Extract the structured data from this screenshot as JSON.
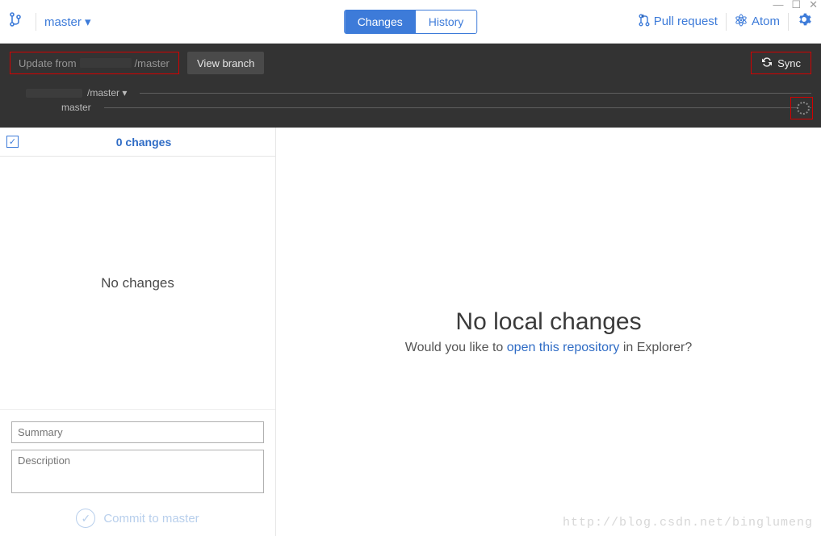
{
  "window_controls": {
    "min": "—",
    "max": "☐",
    "close": "✕"
  },
  "header": {
    "branch_label": "master ▾",
    "tabs": {
      "changes": "Changes",
      "history": "History"
    },
    "pull_request": "Pull request",
    "atom": "Atom"
  },
  "darkbar": {
    "update_prefix": "Update from",
    "update_suffix": "/master",
    "view_branch": "View branch",
    "sync": "Sync",
    "line1_suffix": "/master ▾",
    "line2": "master"
  },
  "sidebar": {
    "changes_count": "0 changes",
    "no_changes": "No changes",
    "summary_ph": "Summary",
    "description_ph": "Description",
    "commit_label": "Commit to master"
  },
  "content": {
    "title": "No local changes",
    "sub_pre": "Would you like to ",
    "sub_link": "open this repository",
    "sub_post": " in Explorer?"
  },
  "watermark": "http://blog.csdn.net/binglumeng"
}
